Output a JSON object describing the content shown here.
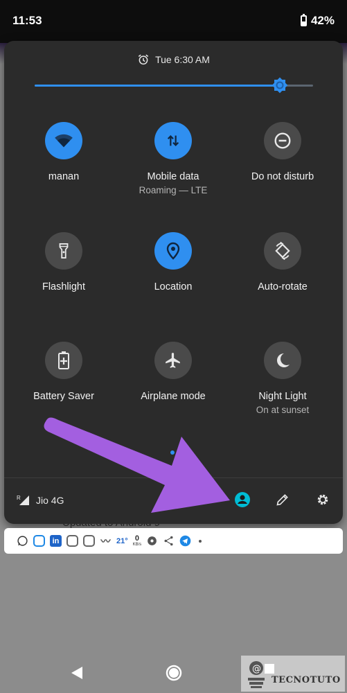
{
  "status_bar": {
    "time": "11:53",
    "battery": "42%",
    "battery_level": 0.42
  },
  "header": {
    "alarm": "Tue 6:30 AM"
  },
  "brightness": {
    "level": 0.88
  },
  "tiles": [
    {
      "label": "manan",
      "sub": "",
      "on": true,
      "icon": "wifi-icon"
    },
    {
      "label": "Mobile data",
      "sub": "Roaming — LTE",
      "on": true,
      "icon": "mobile-data-icon"
    },
    {
      "label": "Do not disturb",
      "sub": "",
      "on": false,
      "icon": "do-not-disturb-icon"
    },
    {
      "label": "Flashlight",
      "sub": "",
      "on": false,
      "icon": "flashlight-icon"
    },
    {
      "label": "Location",
      "sub": "",
      "on": true,
      "icon": "location-icon"
    },
    {
      "label": "Auto-rotate",
      "sub": "",
      "on": false,
      "icon": "auto-rotate-icon"
    },
    {
      "label": "Battery Saver",
      "sub": "",
      "on": false,
      "icon": "battery-saver-icon"
    },
    {
      "label": "Airplane mode",
      "sub": "",
      "on": false,
      "icon": "airplane-icon"
    },
    {
      "label": "Night Light",
      "sub": "On at sunset",
      "on": false,
      "icon": "night-light-icon"
    }
  ],
  "footer": {
    "carrier": "Jio 4G",
    "roaming_mark": "R"
  },
  "background_text": "Updated to Android 9",
  "notification_bar": {
    "temperature": "21°",
    "speed_value": "0",
    "speed_unit": "KB/s"
  },
  "watermark": {
    "text": "TECNOTUTO"
  },
  "colors": {
    "accent": "#2f8ff0",
    "panel": "#2b2b2b",
    "arrow": "#a35fe0",
    "account": "#00bcd4"
  }
}
